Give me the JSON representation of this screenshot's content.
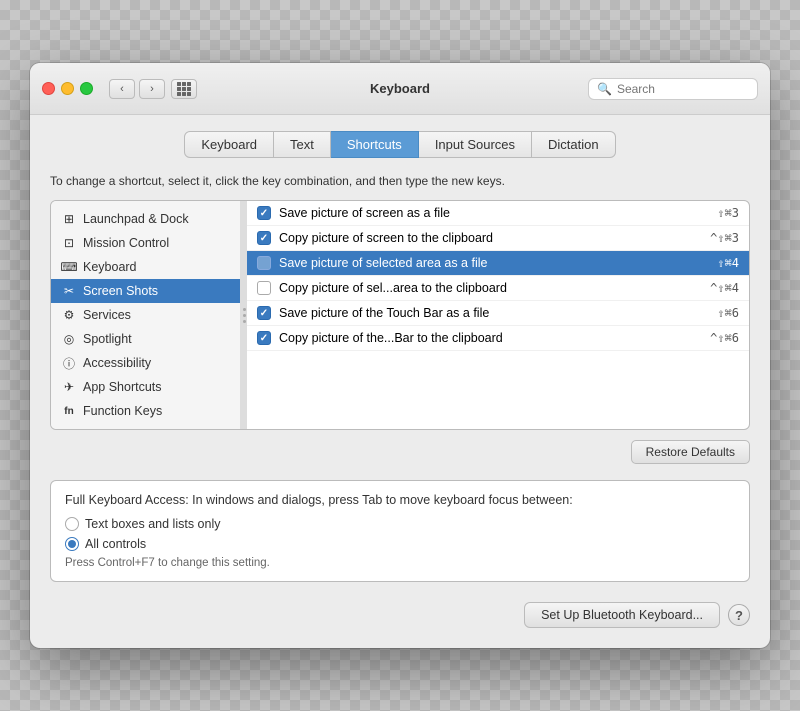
{
  "window": {
    "title": "Keyboard"
  },
  "titlebar": {
    "back_label": "‹",
    "forward_label": "›",
    "search_placeholder": "Search"
  },
  "tabs": [
    {
      "id": "keyboard",
      "label": "Keyboard",
      "active": false
    },
    {
      "id": "text",
      "label": "Text",
      "active": false
    },
    {
      "id": "shortcuts",
      "label": "Shortcuts",
      "active": true
    },
    {
      "id": "input-sources",
      "label": "Input Sources",
      "active": false
    },
    {
      "id": "dictation",
      "label": "Dictation",
      "active": false
    }
  ],
  "instructions": "To change a shortcut, select it, click the key combination, and then type the new keys.",
  "sidebar": {
    "items": [
      {
        "id": "launchpad",
        "label": "Launchpad & Dock",
        "icon": "⊞",
        "selected": false
      },
      {
        "id": "mission-control",
        "label": "Mission Control",
        "icon": "⊡",
        "selected": false
      },
      {
        "id": "keyboard",
        "label": "Keyboard",
        "icon": "⌨",
        "selected": false
      },
      {
        "id": "screenshots",
        "label": "Screen Shots",
        "icon": "✂",
        "selected": true
      },
      {
        "id": "services",
        "label": "Services",
        "icon": "⚙",
        "selected": false
      },
      {
        "id": "spotlight",
        "label": "Spotlight",
        "icon": "◎",
        "selected": false
      },
      {
        "id": "accessibility",
        "label": "Accessibility",
        "icon": "ⓘ",
        "selected": false
      },
      {
        "id": "app-shortcuts",
        "label": "App Shortcuts",
        "icon": "✈",
        "selected": false
      },
      {
        "id": "function-keys",
        "label": "Function Keys",
        "icon": "fn",
        "selected": false
      }
    ]
  },
  "shortcuts": [
    {
      "id": "save-screen-file",
      "label": "Save picture of screen as a file",
      "checked": true,
      "key": "⇧⌘3",
      "selected": false
    },
    {
      "id": "copy-screen-clipboard",
      "label": "Copy picture of screen to the clipboard",
      "checked": true,
      "key": "^⇧⌘3",
      "selected": false
    },
    {
      "id": "save-area-file",
      "label": "Save picture of selected area as a file",
      "checked": false,
      "key": "⇧⌘4",
      "selected": true
    },
    {
      "id": "copy-area-clipboard",
      "label": "Copy picture of sel...area to the clipboard",
      "checked": false,
      "key": "^⇧⌘4",
      "selected": false
    },
    {
      "id": "save-touchbar-file",
      "label": "Save picture of the Touch Bar as a file",
      "checked": true,
      "key": "⇧⌘6",
      "selected": false
    },
    {
      "id": "copy-touchbar-clipboard",
      "label": "Copy picture of the...Bar to the clipboard",
      "checked": true,
      "key": "^⇧⌘6",
      "selected": false
    }
  ],
  "restore_defaults_label": "Restore Defaults",
  "keyboard_access": {
    "title": "Full Keyboard Access: In windows and dialogs, press Tab to move keyboard focus between:",
    "options": [
      {
        "id": "text-boxes",
        "label": "Text boxes and lists only",
        "selected": false
      },
      {
        "id": "all-controls",
        "label": "All controls",
        "selected": true
      }
    ],
    "hint": "Press Control+F7 to change this setting."
  },
  "footer": {
    "bluetooth_label": "Set Up Bluetooth Keyboard...",
    "help_label": "?"
  }
}
